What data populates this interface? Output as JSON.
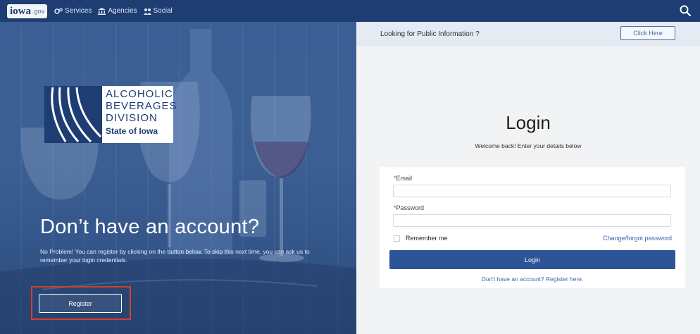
{
  "topbar": {
    "logo_main": "iowa",
    "logo_sub": ".gov",
    "nav": [
      {
        "label": "Services",
        "icon": "gears-icon"
      },
      {
        "label": "Agencies",
        "icon": "building-icon"
      },
      {
        "label": "Social",
        "icon": "people-icon"
      }
    ],
    "search_icon": "search-icon"
  },
  "hero": {
    "brand_lines": [
      "ALCOHOLIC",
      "BEVERAGES",
      "DIVISION"
    ],
    "brand_state": "State of Iowa",
    "heading": "Don’t have an account?",
    "description": "No Problem! You can register by clicking on the button below. To skip this next time, you can ask us to remember your login credentials.",
    "register_label": "Register"
  },
  "info_bar": {
    "text": "Looking for Public Information ?",
    "button_label": "Click Here"
  },
  "login": {
    "title": "Login",
    "subtitle": "Welcome back! Enter your details below",
    "required_mark": "*",
    "email_label": "Email",
    "email_value": "",
    "password_label": "Password",
    "password_value": "",
    "remember_label": "Remember me",
    "forgot_label": "Change/forgot password",
    "button_label": "Login",
    "register_link": "Don't have an account? Register here."
  },
  "colors": {
    "brand": "#1d3d73",
    "primary": "#2d5497",
    "link": "#3d67b0",
    "highlight": "#d2402c"
  }
}
